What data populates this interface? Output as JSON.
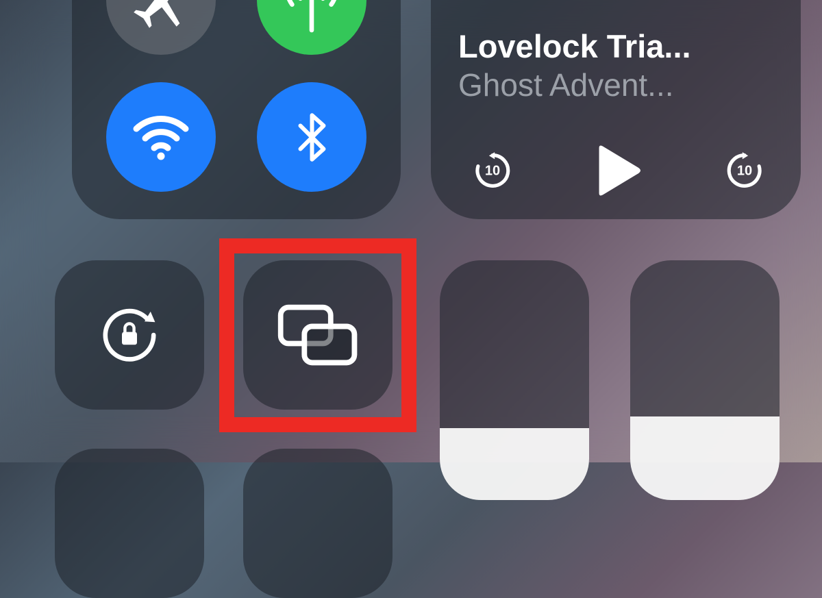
{
  "connectivity": {
    "airplane": {
      "active": false
    },
    "cellular": {
      "active": true,
      "color": "#34c759"
    },
    "wifi": {
      "active": true,
      "color": "#1e7dfc"
    },
    "bluetooth": {
      "active": true,
      "color": "#1e7dfc"
    }
  },
  "media": {
    "title": "Lovelock Tria...",
    "subtitle": "Ghost Advent...",
    "back_seconds": "10",
    "forward_seconds": "10"
  },
  "sliders": {
    "brightness_pct": 30,
    "volume_pct": 35
  },
  "highlight_color": "#ed2a24"
}
